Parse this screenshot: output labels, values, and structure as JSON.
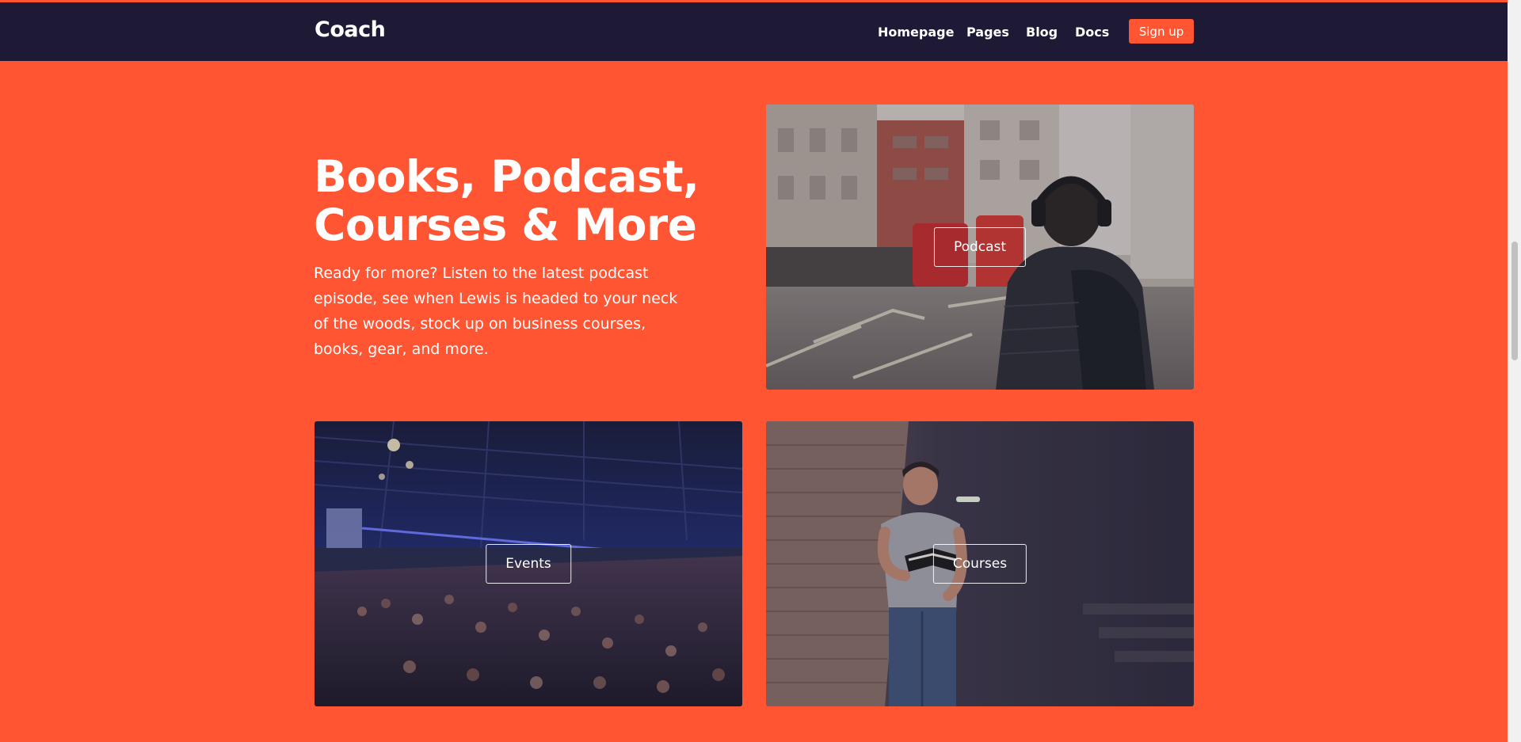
{
  "navbar": {
    "brand": "Coach",
    "links": [
      "Homepage",
      "Pages",
      "Blog",
      "Docs"
    ],
    "signup_label": "Sign up"
  },
  "hero": {
    "title": "Books, Podcast, Courses & More",
    "description": "Ready for more? Listen to the latest podcast episode, see when Lewis is headed to your neck of the woods, stock up on business courses, books, gear, and more."
  },
  "cards": {
    "podcast": {
      "label": "Podcast"
    },
    "events": {
      "label": "Events"
    },
    "courses": {
      "label": "Courses"
    }
  },
  "colors": {
    "accent": "#ff5533",
    "nav_bg": "#1e1a36",
    "text": "#ffffff"
  }
}
